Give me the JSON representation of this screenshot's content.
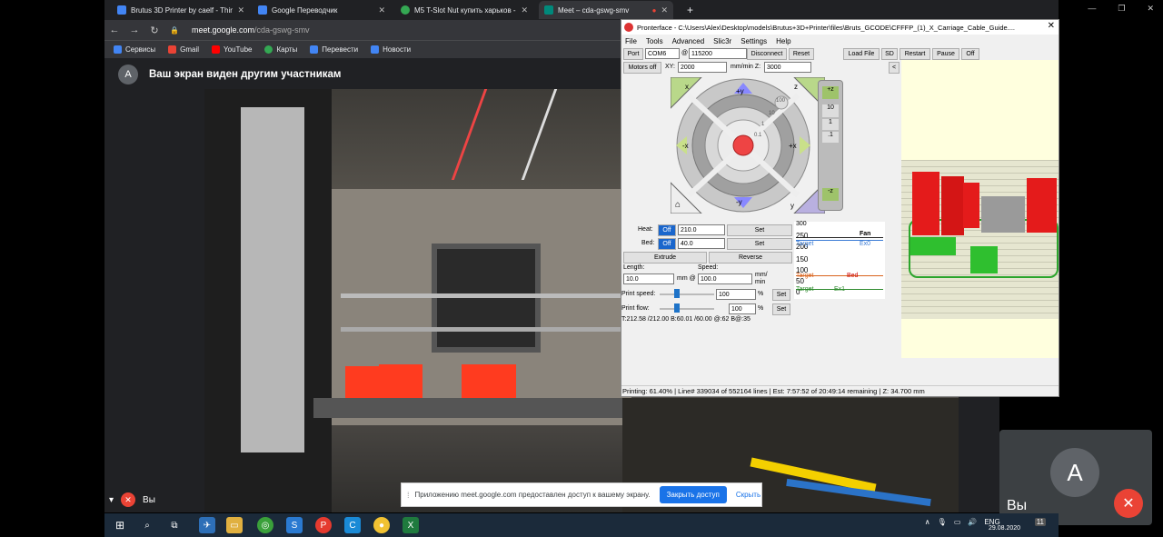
{
  "browser": {
    "tabs": [
      {
        "title": "Brutus 3D Printer by caelf - Thing",
        "color": "#4285f4",
        "active": false
      },
      {
        "title": "Google Переводчик",
        "color": "#4285f4",
        "active": false
      },
      {
        "title": "M5 T-Slot Nut купить харьков -",
        "color": "#34a853",
        "active": false
      },
      {
        "title": "Meet – cda-gswg-smv",
        "color": "#00897b",
        "active": true
      }
    ],
    "new_tab": "+",
    "url_host": "meet.google.com",
    "url_path": "/cda-gswg-smv",
    "bookmarks": [
      {
        "label": "Сервисы",
        "color": "#4285f4"
      },
      {
        "label": "Gmail",
        "color": "#ea4335"
      },
      {
        "label": "YouTube",
        "color": "#ff0000"
      },
      {
        "label": "Карты",
        "color": "#34a853"
      },
      {
        "label": "Перевести",
        "color": "#4285f4"
      },
      {
        "label": "Новости",
        "color": "#4285f4"
      }
    ]
  },
  "meet": {
    "presenter_initial": "A",
    "presenting_text": "Ваш экран виден другим участникам",
    "self_label": "Вы",
    "self_initial": "A",
    "self_name": "Вы",
    "share_notice": {
      "text": "Приложению meet.google.com предоставлен доступ к вашему экрану.",
      "stop_button": "Закрыть доступ",
      "hide_button": "Скрыть"
    }
  },
  "pronterface": {
    "title": "Pronterface - C:\\Users\\Alex\\Desktop\\models\\Brutus+3D+Printer\\files\\Bruts_GCODE\\CFFFP_(1)_X_Carriage_Cable_Guide....",
    "menu": [
      "File",
      "Tools",
      "Advanced",
      "Slic3r",
      "Settings",
      "Help"
    ],
    "port_label": "Port",
    "port_value": "COM6",
    "baud_at": "@",
    "baud_value": "115200",
    "disconnect": "Disconnect",
    "reset": "Reset",
    "load_file": "Load File",
    "sd": "SD",
    "restart": "Restart",
    "pause": "Pause",
    "off": "Off",
    "motors_off": "Motors off",
    "xy_label": "XY:",
    "xy_value": "2000",
    "z_label": "mm/min Z:",
    "z_value": "3000",
    "collapse": "<",
    "jog": {
      "home_x": "x",
      "home_z": "z",
      "home_y": "y",
      "plus_y": "+y",
      "minus_y": "-y",
      "minus_x": "-x",
      "plus_x": "+x",
      "steps": [
        "100",
        "10",
        "1",
        "0.1"
      ],
      "z_plus": "+z",
      "z_minus": "-z",
      "z_steps": [
        "10",
        "1",
        ".1"
      ]
    },
    "heat_label": "Heat:",
    "heat_off": "Off",
    "heat_value": "210.0",
    "bed_label": "Bed:",
    "bed_off": "Off",
    "bed_value": "40.0",
    "set": "Set",
    "extrude": "Extrude",
    "reverse": "Reverse",
    "length_label": "Length:",
    "length_value": "10.0",
    "length_unit": "mm @",
    "speed_label": "Speed:",
    "speed_value": "100.0",
    "speed_unit": "mm/\nmin",
    "print_speed_label": "Print speed:",
    "print_speed_value": "100",
    "print_flow_label": "Print flow:",
    "print_flow_value": "100",
    "pct": "%",
    "temps_readout": "T:212.58 /212.00 B:60.01 /60.00 @:62 B@:35",
    "graph": {
      "ticks": [
        "300",
        "250",
        "200",
        "150",
        "100",
        "50",
        "0"
      ],
      "fan": "Fan",
      "target_ex0": "Target",
      "ex0": "Ex0",
      "target_bed": "Target",
      "bed": "Bed",
      "target_ex1": "Target",
      "ex1": "Ex1"
    },
    "status": "Printing: 61.40% | Line# 339034 of 552164 lines | Est: 7:57:52 of 20:49:14 remaining |  Z: 34.700 mm"
  },
  "taskbar": {
    "lang": "ENG",
    "date": "29.08.2020",
    "notif": "11"
  },
  "colors": {
    "meet_red": "#ea4335",
    "meet_blue": "#1a73e8",
    "chrome_dark": "#202124",
    "prontr_red": "#e02020"
  }
}
